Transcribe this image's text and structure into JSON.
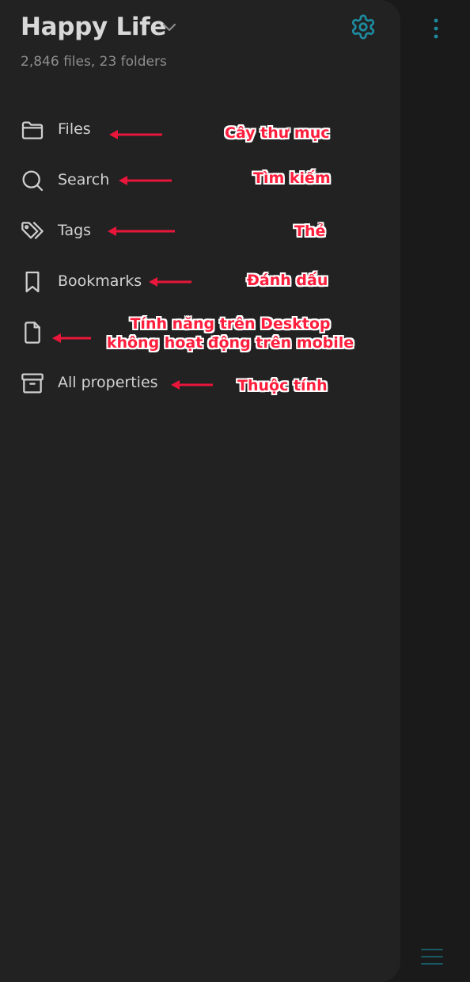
{
  "colors": {
    "accent": "#1e8ba0",
    "panel_bg": "#222222",
    "background": "#1a1a1a",
    "annotation": "#ff1e3c",
    "annotation_outline": "#ffffff"
  },
  "header": {
    "vault_name": "Happy Life",
    "stats": "2,846 files, 23 folders",
    "chevron_icon": "chevron-down-icon",
    "settings_icon": "gear-icon",
    "more_icon": "more-vertical-icon"
  },
  "nav": {
    "items": [
      {
        "label": "Files",
        "icon": "folder-icon"
      },
      {
        "label": "Search",
        "icon": "search-icon"
      },
      {
        "label": "Tags",
        "icon": "tags-icon"
      },
      {
        "label": "Bookmarks",
        "icon": "bookmark-icon"
      },
      {
        "label": "",
        "icon": "file-icon"
      },
      {
        "label": "All properties",
        "icon": "archive-icon"
      }
    ]
  },
  "annotations": {
    "files": "Cây thư mục",
    "search": "Tìm kiếm",
    "tags": "Thẻ",
    "bookmarks": "Đánh dấu",
    "desktop_line1": "Tính năng trên Desktop",
    "desktop_line2": "không hoạt động trên mobile",
    "properties": "Thuộc tính"
  },
  "footer": {
    "menu_icon": "hamburger-menu-icon"
  }
}
